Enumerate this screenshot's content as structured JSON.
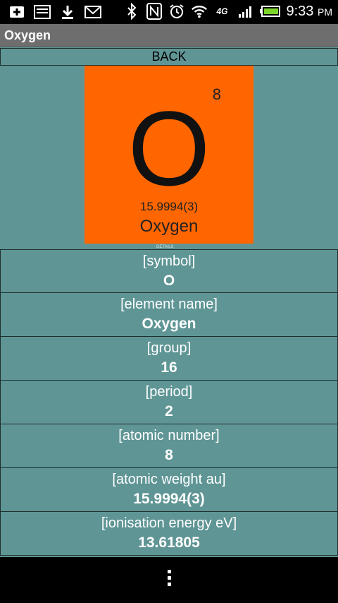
{
  "status_bar": {
    "icons": [
      "add-notification-icon",
      "screenshot-icon",
      "download-icon",
      "gmail-icon",
      "bluetooth-icon",
      "nfc-icon",
      "alarm-icon",
      "wifi-icon",
      "4g-lte-icon",
      "signal-icon",
      "battery-icon"
    ],
    "network_label": "4G",
    "time": "9:33",
    "ampm": "PM"
  },
  "app": {
    "title": "Oxygen"
  },
  "back_label": "BACK",
  "tile": {
    "atomic_number": "8",
    "symbol": "O",
    "atomic_weight": "15.9994(3)",
    "name": "Oxygen",
    "color": "#ff6600",
    "detail_tag": "DETAILS"
  },
  "rows": [
    {
      "label": "[symbol]",
      "value": "O"
    },
    {
      "label": "[element name]",
      "value": "Oxygen"
    },
    {
      "label": "[group]",
      "value": "16"
    },
    {
      "label": "[period]",
      "value": "2"
    },
    {
      "label": "[atomic number]",
      "value": "8"
    },
    {
      "label": "[atomic weight au]",
      "value": "15.9994(3)"
    },
    {
      "label": "[ionisation energy eV]",
      "value": "13.61805"
    }
  ],
  "colors": {
    "content_background": "#5f9595",
    "title_bar": "#6e6e6e"
  }
}
